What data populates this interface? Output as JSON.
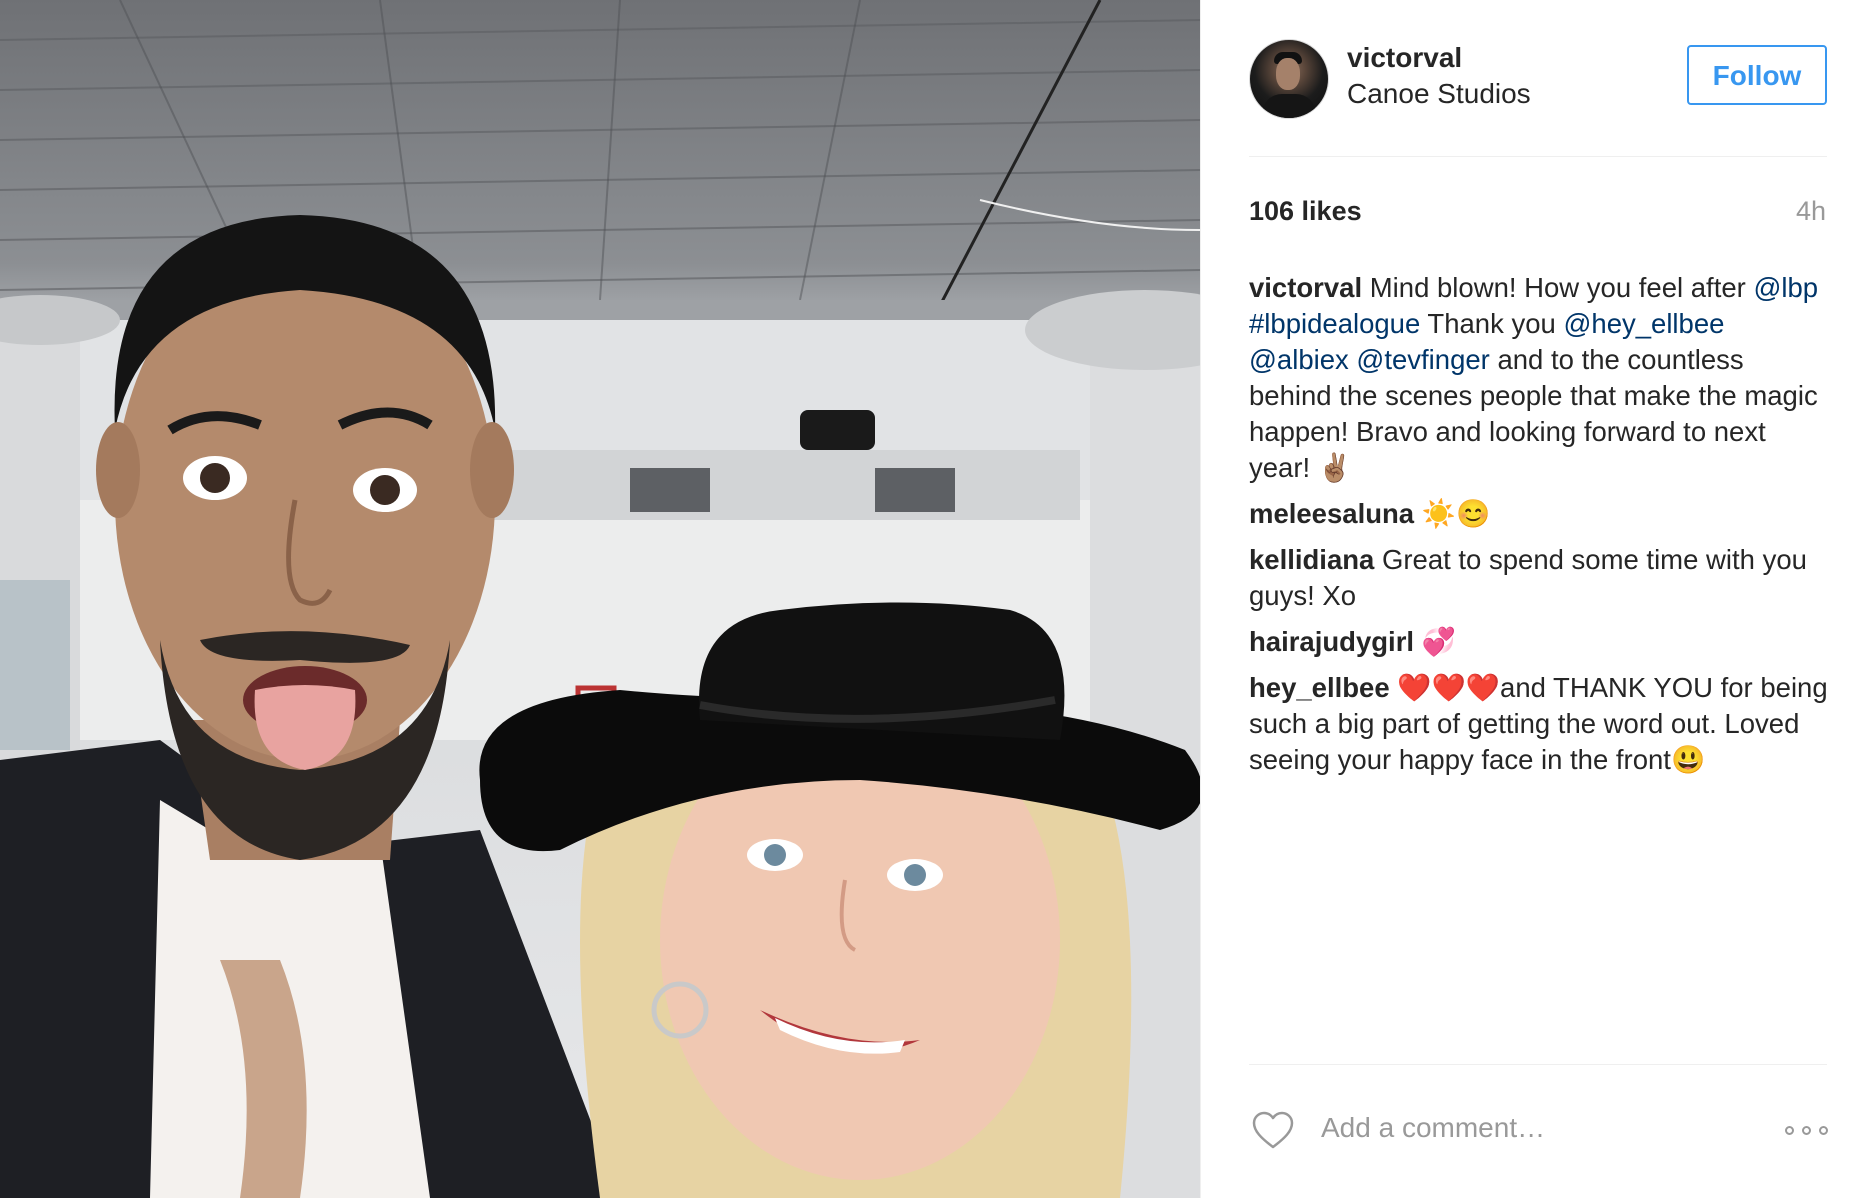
{
  "post": {
    "username": "victorval",
    "location": "Canoe Studios",
    "follow_label": "Follow",
    "likes": "106 likes",
    "time": "4h",
    "caption": {
      "user": "victorval",
      "t1": " Mind blown! How you feel after ",
      "m1": "@lbp",
      "h1": "#lbpidealogue",
      "t2": " Thank you ",
      "m2": "@hey_ellbee",
      "m3": "@albiex",
      "m4": "@tevfinger",
      "t3": " and to the countless behind the scenes people that make the magic happen! Bravo and looking forward to next year! ✌🏽"
    },
    "comments": [
      {
        "user": "meleesaluna",
        "text": " ☀️😊"
      },
      {
        "user": "kellidiana",
        "text": " Great to spend some time with you guys! Xo"
      },
      {
        "user": "hairajudygirl",
        "text": " 💞"
      },
      {
        "user": "hey_ellbee",
        "text": " ❤️❤️❤️and THANK YOU for being such a big part of getting the word out. Loved seeing your happy face in the front😃"
      }
    ],
    "add_comment_placeholder": "Add a comment…"
  },
  "icons": {
    "like": "heart-outline-icon",
    "more": "more-options-icon"
  },
  "colors": {
    "follow_blue": "#3897f0",
    "link": "#003569",
    "muted": "#999999",
    "text": "#262626"
  }
}
